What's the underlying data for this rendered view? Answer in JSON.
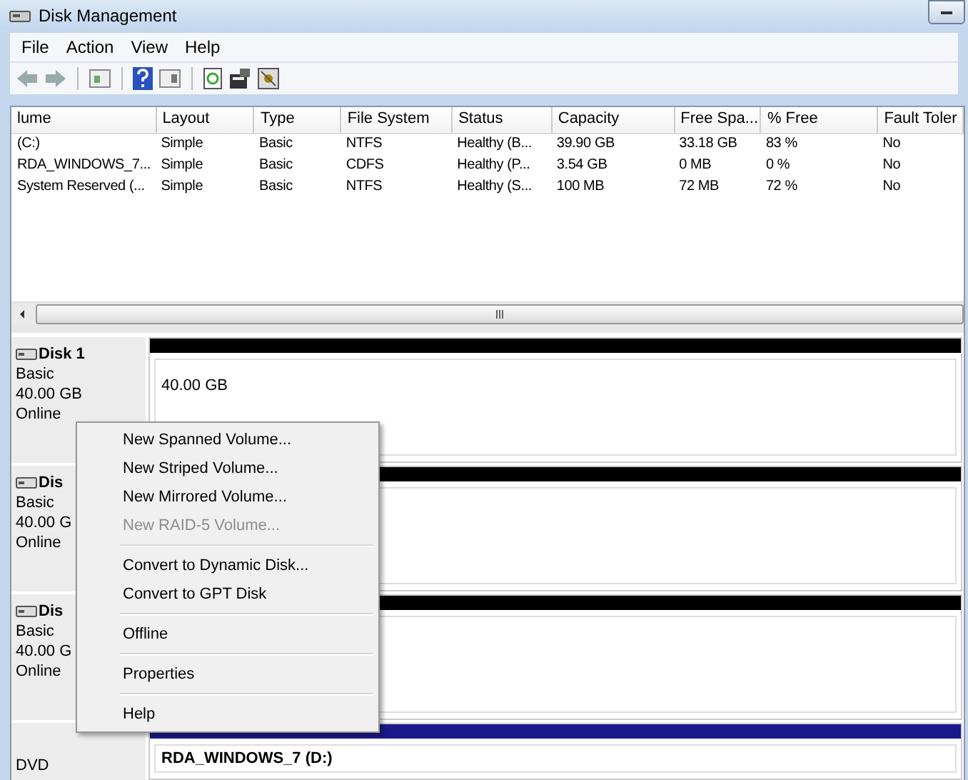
{
  "window": {
    "title": "Disk Management"
  },
  "menu": [
    "File",
    "Action",
    "View",
    "Help"
  ],
  "table": {
    "columns": [
      "lume",
      "Layout",
      "Type",
      "File System",
      "Status",
      "Capacity",
      "Free Spa...",
      "% Free",
      "Fault Toler"
    ],
    "rows": [
      [
        "(C:)",
        "Simple",
        "Basic",
        "NTFS",
        "Healthy (B...",
        "39.90 GB",
        "33.18 GB",
        "83 %",
        "No"
      ],
      [
        "RDA_WINDOWS_7...",
        "Simple",
        "Basic",
        "CDFS",
        "Healthy (P...",
        "3.54 GB",
        "0 MB",
        "0 %",
        "No"
      ],
      [
        "System Reserved (...",
        "Simple",
        "Basic",
        "NTFS",
        "Healthy (S...",
        "100 MB",
        "72 MB",
        "72 %",
        "No"
      ]
    ]
  },
  "disks": [
    {
      "name": "Disk 1",
      "type": "Basic",
      "size": "40.00 GB",
      "status": "Online",
      "volume_size": "40.00 GB",
      "kind": "disk"
    },
    {
      "name": "Dis",
      "type": "Basic",
      "size": "40.00 G",
      "status": "Online",
      "kind": "disk"
    },
    {
      "name": "Dis",
      "type": "Basic",
      "size": "40.00 G",
      "status": "Online",
      "kind": "disk"
    },
    {
      "type": "DVD",
      "volume_name": "RDA_WINDOWS_7  (D:)",
      "kind": "cdrom"
    }
  ],
  "context_menu": [
    {
      "kind": "item",
      "label": "New Spanned Volume...",
      "disabled": false
    },
    {
      "kind": "item",
      "label": "New Striped Volume...",
      "disabled": false
    },
    {
      "kind": "item",
      "label": "New Mirrored Volume...",
      "disabled": false
    },
    {
      "kind": "item",
      "label": "New RAID-5 Volume...",
      "disabled": true
    },
    {
      "kind": "separator"
    },
    {
      "kind": "item",
      "label": "Convert to Dynamic Disk...",
      "disabled": false
    },
    {
      "kind": "item",
      "label": "Convert to GPT Disk",
      "disabled": false
    },
    {
      "kind": "separator"
    },
    {
      "kind": "item",
      "label": "Offline",
      "disabled": false
    },
    {
      "kind": "separator"
    },
    {
      "kind": "item",
      "label": "Properties",
      "disabled": false
    },
    {
      "kind": "separator"
    },
    {
      "kind": "item",
      "label": "Help",
      "disabled": false
    }
  ]
}
